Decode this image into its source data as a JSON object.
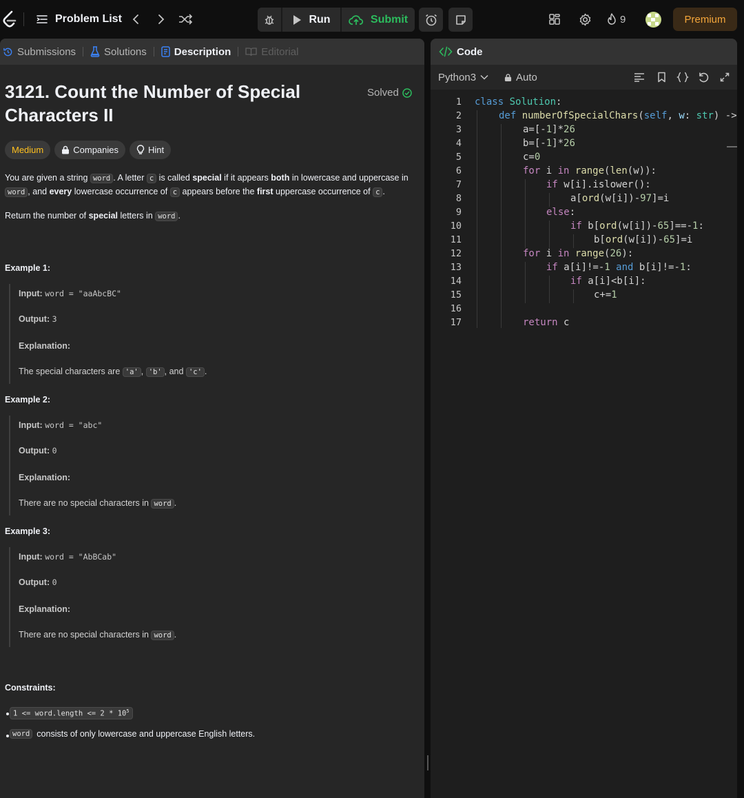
{
  "topbar": {
    "problem_list": "Problem List",
    "run": "Run",
    "submit": "Submit",
    "streak": "9",
    "premium": "Premium"
  },
  "left": {
    "tabs": [
      "Submissions",
      "Solutions",
      "Description",
      "Editorial"
    ],
    "title": "3121. Count the Number of Special Characters II",
    "solved": "Solved",
    "chips": [
      "Medium",
      "Companies",
      "Hint"
    ],
    "para1": {
      "t1": "You are given a string ",
      "c1": "word",
      "t2": ". A letter ",
      "c2": "c",
      "t3": " is called ",
      "b1": "special",
      "t4": " if it appears ",
      "b2": "both",
      "t5": " in lowercase and uppercase in",
      "c3": "word",
      "t6": ", and ",
      "b3": "every",
      "t7": " lowercase occurrence of ",
      "c4": "c",
      "t8": " appears before the ",
      "b4": "first",
      "t9": " uppercase occurrence of ",
      "c5": "c",
      "t10": "."
    },
    "para2": {
      "t1": "Return the number of ",
      "b1": "special",
      "t2": " letters in ",
      "c1": "word",
      "t3": "."
    },
    "examples": [
      {
        "heading": "Example 1:",
        "input_label": "Input:",
        "input": "word = \"aaAbcBC\"",
        "output_label": "Output:",
        "output": "3",
        "explanation_label": "Explanation:",
        "explanation": "The special characters are ",
        "codes": [
          "'a'",
          "'b'",
          "'c'"
        ],
        "sep1": ", ",
        "sep2": ", and ",
        "end": "."
      },
      {
        "heading": "Example 2:",
        "input_label": "Input:",
        "input": "word = \"abc\"",
        "output_label": "Output:",
        "output": "0",
        "explanation_label": "Explanation:",
        "explanation": "There are no special characters in ",
        "code": "word",
        "end": "."
      },
      {
        "heading": "Example 3:",
        "input_label": "Input:",
        "input": "word = \"AbBCab\"",
        "output_label": "Output:",
        "output": "0",
        "explanation_label": "Explanation:",
        "explanation": "There are no special characters in ",
        "code": "word",
        "end": "."
      }
    ],
    "constraints_heading": "Constraints:",
    "constraint1": "1 <= word.length <= 2 * 10",
    "constraint1_sup": "5",
    "constraint2_code": "word",
    "constraint2_text": " consists of only lowercase and uppercase English letters."
  },
  "right": {
    "code_tab": "Code",
    "language": "Python3",
    "mode": "Auto"
  },
  "code": {
    "line_numbers": [
      "1",
      "2",
      "3",
      "4",
      "5",
      "6",
      "7",
      "8",
      "9",
      "10",
      "11",
      "12",
      "13",
      "14",
      "15",
      "16",
      "17"
    ],
    "l1": {
      "kw": "class",
      "cls": "Solution",
      "p": ":"
    },
    "l2": {
      "kw": "def",
      "fn": "numberOfSpecialChars",
      "p1": "(",
      "self": "self",
      "p2": ", ",
      "w": "w",
      "p3": ": ",
      "ty": "str",
      "p4": ") ->"
    },
    "l3": {
      "t1": "a=[-",
      "n1": "1",
      "t2": "]*",
      "n2": "26"
    },
    "l4": {
      "t1": "b=[-",
      "n1": "1",
      "t2": "]*",
      "n2": "26"
    },
    "l5": {
      "t1": "c=",
      "n1": "0"
    },
    "l6": {
      "k1": "for",
      "t1": " i ",
      "k2": "in",
      "t2": " ",
      "b1": "range",
      "t3": "(",
      "b2": "len",
      "t4": "(w)):"
    },
    "l7": {
      "k1": "if",
      "t1": " w[i].islower():"
    },
    "l8": {
      "t1": "a[",
      "b1": "ord",
      "t2": "(w[i])-",
      "n1": "97",
      "t3": "]=i"
    },
    "l9": {
      "k1": "else",
      "t1": ":"
    },
    "l10": {
      "k1": "if",
      "t1": " b[",
      "b1": "ord",
      "t2": "(w[i])-",
      "n1": "65",
      "t3": "]==-",
      "n2": "1",
      "t4": ":"
    },
    "l11": {
      "t1": "b[",
      "b1": "ord",
      "t2": "(w[i])-",
      "n1": "65",
      "t3": "]=i"
    },
    "l12": {
      "k1": "for",
      "t1": " i ",
      "k2": "in",
      "t2": " ",
      "b1": "range",
      "t3": "(",
      "n1": "26",
      "t4": "):"
    },
    "l13": {
      "k1": "if",
      "t1": " a[i]!=-",
      "n1": "1",
      "t2": " ",
      "k2": "and",
      "t3": " b[i]!=-",
      "n2": "1",
      "t4": ":"
    },
    "l14": {
      "k1": "if",
      "t1": " a[i]<b[i]:"
    },
    "l15": {
      "t1": "c+=",
      "n1": "1"
    },
    "l17": {
      "k1": "return",
      "t1": " c"
    }
  }
}
